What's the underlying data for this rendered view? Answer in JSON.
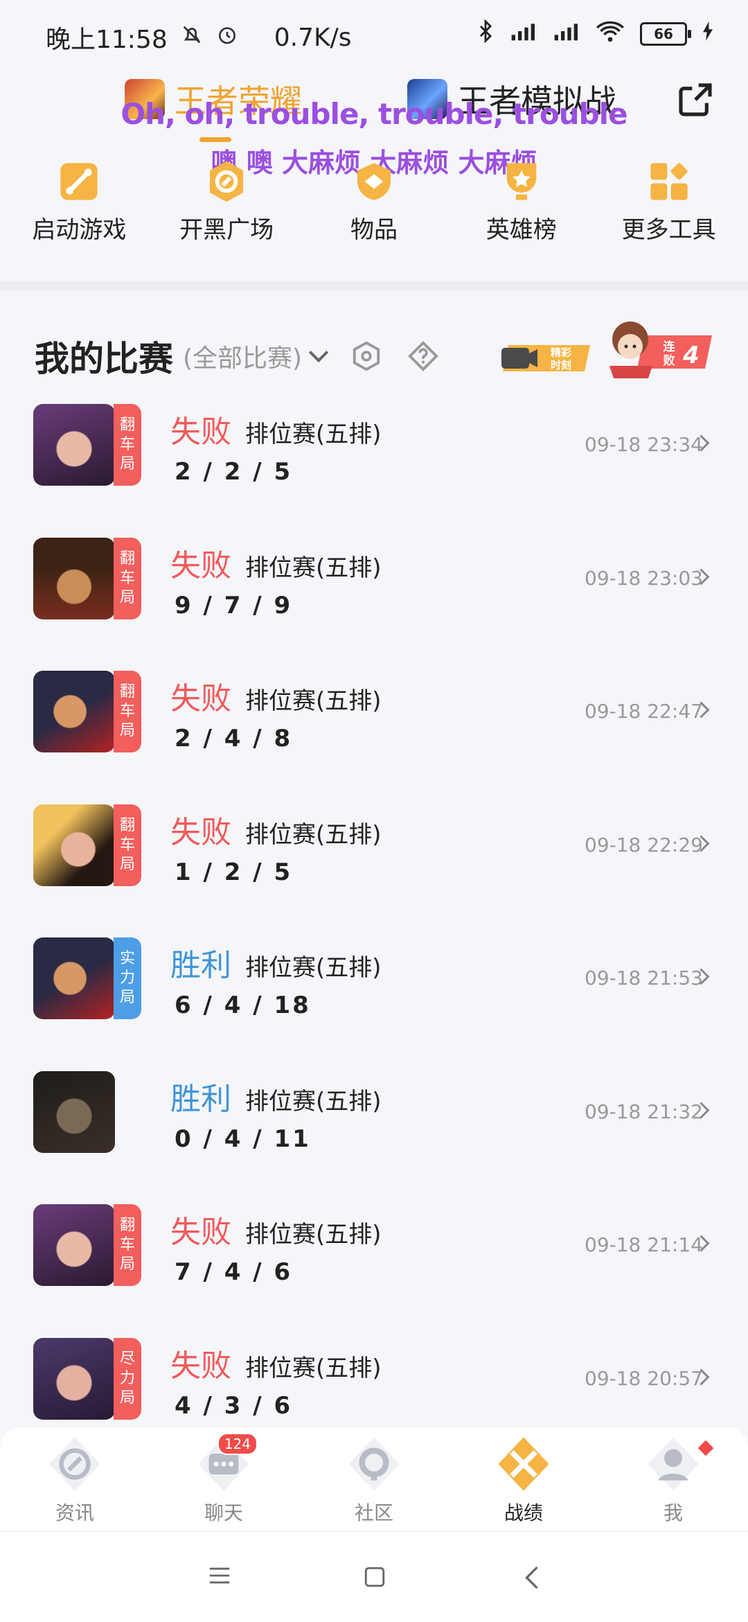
{
  "status_bar": {
    "time": "晚上11:58",
    "net_speed": "0.7K/s",
    "battery": "66",
    "icons": [
      "mute-bell-icon",
      "alarm-icon",
      "bluetooth-icon",
      "signal-icon",
      "wifi-icon",
      "battery-icon",
      "charging-icon"
    ]
  },
  "header": {
    "tabs": [
      {
        "label": "王者荣耀",
        "active": true
      },
      {
        "label": "王者模拟战",
        "active": false
      }
    ],
    "overlay_line1": "Oh, oh, trouble, trouble, trouble",
    "overlay_line2": "噢 噢 大麻烦 大麻烦 大麻烦",
    "accent": "#f0a431"
  },
  "tools": [
    {
      "label": "启动游戏",
      "icon": "launch-game-icon"
    },
    {
      "label": "开黑广场",
      "icon": "team-square-icon"
    },
    {
      "label": "物品",
      "icon": "items-icon"
    },
    {
      "label": "英雄榜",
      "icon": "hero-ranking-icon"
    },
    {
      "label": "更多工具",
      "icon": "more-tools-icon"
    }
  ],
  "section": {
    "title": "我的比赛",
    "filter": "(全部比赛)",
    "banner_highlight": "精彩时刻",
    "banner_streak_label": "连败",
    "banner_streak_count": "4"
  },
  "matches": [
    {
      "tag": "翻车局",
      "tag_color": "red",
      "result": "失败",
      "outcome": "lose",
      "mode": "排位赛(五排)",
      "kda": "2 / 2 / 5",
      "time": "09-18 23:34",
      "hero_colors": [
        "#6a3c7a",
        "#e9b9a7",
        "#2a1a30"
      ]
    },
    {
      "tag": "翻车局",
      "tag_color": "red",
      "result": "失败",
      "outcome": "lose",
      "mode": "排位赛(五排)",
      "kda": "9 / 7 / 9",
      "time": "09-18 23:03",
      "hero_colors": [
        "#3b2415",
        "#c98d58",
        "#7a2c1e"
      ]
    },
    {
      "tag": "翻车局",
      "tag_color": "red",
      "result": "失败",
      "outcome": "lose",
      "mode": "排位赛(五排)",
      "kda": "2 / 4 / 8",
      "time": "09-18 22:47",
      "hero_colors": [
        "#2a2a44",
        "#d89866",
        "#b52222"
      ]
    },
    {
      "tag": "翻车局",
      "tag_color": "red",
      "result": "失败",
      "outcome": "lose",
      "mode": "排位赛(五排)",
      "kda": "1 / 2 / 5",
      "time": "09-18 22:29",
      "hero_colors": [
        "#f1c15c",
        "#e8b39a",
        "#241812"
      ]
    },
    {
      "tag": "实力局",
      "tag_color": "blue",
      "result": "胜利",
      "outcome": "win",
      "mode": "排位赛(五排)",
      "kda": "6 / 4 / 18",
      "time": "09-18 21:53",
      "hero_colors": [
        "#2a2a44",
        "#d89866",
        "#b52222"
      ]
    },
    {
      "tag": "",
      "tag_color": "none",
      "result": "胜利",
      "outcome": "win",
      "mode": "排位赛(五排)",
      "kda": "0 / 4 / 11",
      "time": "09-18 21:32",
      "hero_colors": [
        "#1f1c1a",
        "#7a6a55",
        "#3a2f28"
      ]
    },
    {
      "tag": "翻车局",
      "tag_color": "red",
      "result": "失败",
      "outcome": "lose",
      "mode": "排位赛(五排)",
      "kda": "7 / 4 / 6",
      "time": "09-18 21:14",
      "hero_colors": [
        "#6a3c7a",
        "#e9b9a7",
        "#2a1a30"
      ]
    },
    {
      "tag": "尽力局",
      "tag_color": "red",
      "result": "失败",
      "outcome": "lose",
      "mode": "排位赛(五排)",
      "kda": "4 / 3 / 6",
      "time": "09-18 20:57",
      "hero_colors": [
        "#4b3a6a",
        "#e4b0a0",
        "#271a35"
      ]
    }
  ],
  "bottom_nav": [
    {
      "label": "资讯",
      "icon": "news-icon",
      "active": false,
      "badge": ""
    },
    {
      "label": "聊天",
      "icon": "chat-icon",
      "active": false,
      "badge": "124"
    },
    {
      "label": "社区",
      "icon": "community-icon",
      "active": false,
      "badge": ""
    },
    {
      "label": "战绩",
      "icon": "record-icon",
      "active": true,
      "badge": ""
    },
    {
      "label": "我",
      "icon": "profile-icon",
      "active": false,
      "badge": "dot"
    }
  ],
  "colors": {
    "lose": "#f05a5a",
    "win": "#3f95d8",
    "accent": "#f0a431"
  }
}
